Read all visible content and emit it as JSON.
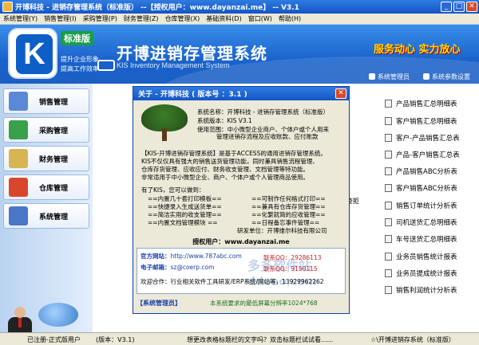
{
  "window": {
    "title": "开博科技  - 进销存管理系统（标准版）  --【授权用户：www.dayanzai.me】 -- V3.1",
    "buttons": {
      "minimize": "_",
      "maximize": "□",
      "close": "✕"
    }
  },
  "menu": [
    "系统管理(Y)",
    "销售管理(I)",
    "采购管理(P)",
    "财务管理(Z)",
    "仓库管理(X)",
    "基础资料(D)",
    "窗口(W)",
    "帮助(H)"
  ],
  "banner": {
    "logo_letter": "K",
    "edition": "标准版",
    "slogan_1": "提升企业形象",
    "slogan_2": "提高工作效率",
    "title": "开博进销存管理系统",
    "subtitle": "KIS Inventory Management System",
    "slogan_right": "服务动心  实力放心",
    "user_link": "系统管理员",
    "settings_link": "系统参数设置"
  },
  "sidebar": [
    {
      "label": "销售管理",
      "icon": "printer-icon",
      "color": "#5a8ad6"
    },
    {
      "label": "采购管理",
      "icon": "book-icon",
      "color": "#39a14a"
    },
    {
      "label": "财务管理",
      "icon": "calculator-icon",
      "color": "#d6b552"
    },
    {
      "label": "仓库管理",
      "icon": "house-icon",
      "color": "#d9472b"
    },
    {
      "label": "系统管理",
      "icon": "gears-icon",
      "color": "#4a76c8"
    }
  ],
  "reports": [
    "产品销售汇总明细表",
    "客户销售汇总明细表",
    "客户-产品销售汇总表",
    "产品-客户销售汇总表",
    "产品销售ABC分析表",
    "客户销售ABC分析表",
    "销售订单统计分析表",
    "司机送货汇总明细表",
    "车号送货汇总明细表",
    "业务员销售统计报表",
    "业务员提成统计报表",
    "销售利润统计分析表"
  ],
  "checkbox_text": "查拒",
  "about": {
    "title": "关于 - 开博科技      ( 版本号 ：3.1 )",
    "name_line": "系统名称：开博科技 - 进销存管理系统（标准版）",
    "version_line": "系统版本：KIS V3.1",
    "usage_line_1": "使用范围：中小微型企业商户、个体户或个人用来",
    "usage_line_2": "管理进销存流程及应收账款、应付账款",
    "desc": [
      "【KIS-开博进销存管理系统】是基于ACCESS的通用进销存管理系统。",
      "  KIS不仅仅具有强大的销售送货管理功能，同时兼具销售流程管理、",
      "仓库存货管理、应收应付、财务收支管理、文档管理等特功能。",
      "非常适用于中小微型企业、商户、个体户或个人管理商品使用。"
    ],
    "features_intro": "有了KIS，您可以做到：",
    "features_left": [
      "==内置几十套打印模板==",
      "==快捷录入生成送货单==",
      "==简洁实用的收支管理==",
      "==内置文档管理模块  =="
    ],
    "features_right": [
      "==可制作任何格式打印==",
      "==兼具有仓库存货管理==",
      "==化繁就简的应收管理==",
      "==日程备忘事件管理=="
    ],
    "developer": "研发单位：开博维尔科技有限公司",
    "auth": "授权用户：www.dayanzai.me",
    "site_label": "官方网站：",
    "site_value": "http://www.787abc.com",
    "email_label": "电子邮箱：",
    "email_value": "sz@coerp.com",
    "qq_1": "联系QQ：29286113",
    "qq_2": "联系QQ：9150115",
    "welcome": "欢迎合作：行业相关软件工具研发/ERP系统/网站等，13929962262",
    "watermark_1": "多多软件站",
    "watermark_2": "ddooo.com",
    "footer_left": "【系统管理员】",
    "footer_right": "本系统要求的最低屏幕分辨率1024*768"
  },
  "status": {
    "reg": "已注册-正式版用户",
    "version": "(版本：V3.1)",
    "hint": "想更改表格标题栏的文字吗？双击标题栏试试看......",
    "right": "☆\\开博进销存系统（标准版）"
  }
}
